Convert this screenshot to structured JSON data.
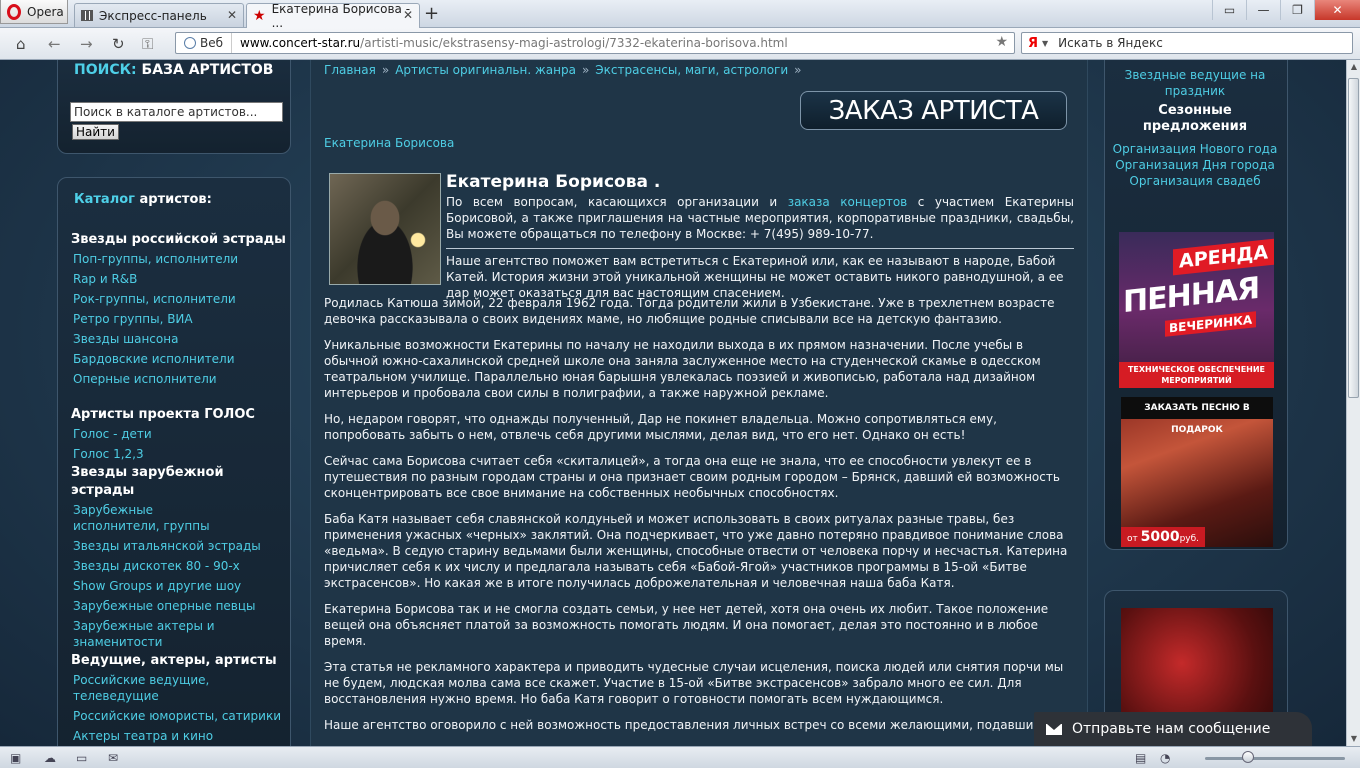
{
  "browser": {
    "menu_label": "Opera",
    "tabs": [
      {
        "label": "Экспресс-панель"
      },
      {
        "label": "Екатерина Борисова - ..."
      }
    ],
    "address": {
      "scheme_label": "Веб",
      "host": "www.concert-star.ru",
      "path": "/artisti-music/ekstrasensy-magi-astrologi/7332-ekaterina-borisova.html"
    },
    "search": {
      "engine_glyph": "Я",
      "placeholder": "Искать в Яндекс"
    }
  },
  "sidebar": {
    "search_title_accent": "ПОИСК:",
    "search_title_rest": "БАЗА АРТИСТОВ",
    "search_placeholder": "Поиск в каталоге артистов...",
    "search_button": "Найти",
    "catalog_title_accent": "Каталог",
    "catalog_title_rest": "артистов:",
    "groups": [
      {
        "heading": "Звезды российской эстрады",
        "links": [
          "Поп-группы, исполнители",
          "Rap и R&B",
          "Рок-группы, исполнители",
          "Ретро группы, ВИА",
          "Звезды шансона",
          "Бардовские исполнители",
          "Оперные исполнители"
        ]
      },
      {
        "heading": "Артисты проекта ГОЛОС",
        "links": [
          "Голос - дети",
          "Голос 1,2,3"
        ]
      },
      {
        "heading": "Звезды зарубежной эстрады",
        "links": [
          "Зарубежные исполнители, группы",
          "Звезды итальянской эстрады",
          "Звезды дискотек 80 - 90-х",
          "Show Groups и другие шоу",
          "Зарубежные оперные певцы",
          "Зарубежные актеры и знаменитости"
        ]
      },
      {
        "heading": "Ведущие, актеры, артисты",
        "links": [
          "Российские ведущие, телеведущие",
          "Российские юмористы, сатирики",
          "Актеры театра и кино"
        ]
      }
    ]
  },
  "main": {
    "breadcrumb": [
      "Главная",
      "Артисты оригинальн. жанра",
      "Экстрасенсы, маги, астрологи"
    ],
    "breadcrumb_sep": "»",
    "order_title": "ЗАКАЗ АРТИСТА",
    "subtitle": "Екатерина Борисова",
    "heading": "Екатерина Борисова .",
    "intro_before": "По всем вопросам, касающихся организации и ",
    "intro_link": "заказа концертов",
    "intro_after": " с участием Екатерины Борисовой, а также приглашения на частные мероприятия, корпоративные праздники, свадьбы, Вы можете обращаться  по телефону в Москве:  + 7(495) 989-10-77.",
    "paragraphs": [
      "Наше агентство поможет вам встретиться с Екатериной или, как ее называют в народе, Бабой Катей. История жизни этой уникальной женщины не может оставить никого равнодушной, а ее дар может оказаться для вас настоящим спасением.",
      "Родилась Катюша зимой, 22 февраля 1962 года. Тогда родители жили в Узбекистане. Уже в трехлетнем возрасте девочка рассказывала о своих видениях маме, но любящие родные списывали все на детскую фантазию.",
      "Уникальные возможности Екатерины по началу не находили выхода в их прямом назначении. После учебы в обычной южно-сахалинской средней школе она заняла заслуженное место на студенческой скамье в одесском театральном училище. Параллельно юная барышня увлекалась поэзией и живописью, работала над дизайном интерьеров и пробовала свои силы в полиграфии, а также наружной рекламе.",
      "Но, недаром говорят, что однажды полученный, Дар не покинет владельца. Можно сопротивляться ему, попробовать забыть о нем, отвлечь себя другими мыслями, делая вид, что его нет. Однако он есть!",
      "Сейчас сама Борисова считает себя «скиталицей», а тогда она еще не знала, что ее способности увлекут ее в путешествия по разным городам страны и она признает своим родным городом – Брянск, давший ей возможность сконцентрировать все свое внимание на собственных необычных способностях.",
      "Баба Катя называет себя славянской колдуньей и может использовать в своих ритуалах разные травы, без применения ужасных «черных» заклятий. Она подчеркивает, что уже давно потеряно правдивое понимание слова «ведьма». В седую старину ведьмами были женщины, способные отвести от человека порчу и несчастья. Катерина причисляет себя к их числу и предлагала называть себя «Бабой-Ягой» участников программы в 15-ой «Битве экстрасенсов». Но какая же в итоге получилась доброжелательная и человечная наша баба Катя.",
      "Екатерина Борисова так и не смогла создать семьи, у нее нет детей, хотя она очень их любит. Такое положение вещей она объясняет платой за возможность помогать людям. И она помогает, делая это постоянно и в любое время.",
      "Эта статья не рекламного характера и приводить чудесные случаи исцеления, поиска людей или снятия порчи мы не будем, людская молва сама все скажет. Участие в 15-ой «Битве экстрасенсов» забрало много ее сил. Для восстановления нужно время. Но баба Катя говорит о готовности помогать всем нуждающимся.",
      "Наше агентство оговорило с ней возможность предоставления личных встреч со всеми желающими, подавшими зая"
    ]
  },
  "right": {
    "top_link": "Звездные ведущие на праздник",
    "season_heading": "Сезонные предложения",
    "season_links": [
      "Организация Нового года",
      "Организация Дня города",
      "Организация свадеб"
    ],
    "banner1": {
      "line1": "АРЕНДА",
      "line2": "ПЕННАЯ",
      "line3": "ВЕЧЕРИНКА",
      "line4": "ТЕХНИЧЕСКОЕ ОБЕСПЕЧЕНИЕ МЕРОПРИЯТИЙ"
    },
    "banner2": {
      "top": "ЗАКАЗАТЬ ПЕСНЮ В ПОДАРОК",
      "price_prefix": "от",
      "price": "5000",
      "price_suffix": "руб."
    }
  },
  "chat": {
    "label": "Отправьте нам сообщение"
  },
  "colors": {
    "accent": "#4ecde4",
    "page_bg": "#1d3142",
    "banner_red": "#e01b25"
  }
}
